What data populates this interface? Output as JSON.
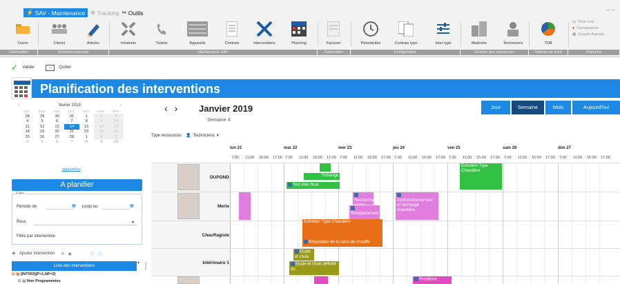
{
  "app_tabs": {
    "active": "SAV - Maintenance",
    "tracking": "Tracking",
    "outils": "Outils"
  },
  "ribbon": {
    "buttons": [
      {
        "label": "Ouvrir",
        "icon": "folder-icon"
      },
      {
        "label": "Clients",
        "icon": "clients-icon"
      },
      {
        "label": "Articles",
        "icon": "pencil-icon"
      },
      {
        "label": "Incidents",
        "icon": "incidents-icon"
      },
      {
        "label": "Tickets",
        "icon": "phone-icon"
      },
      {
        "label": "Appareils",
        "icon": "appliance-icon"
      },
      {
        "label": "Contrats",
        "icon": "contract-icon"
      },
      {
        "label": "Interventions",
        "icon": "tools-icon"
      },
      {
        "label": "Planning",
        "icon": "calendar-icon"
      },
      {
        "label": "Facturer",
        "icon": "invoice-icon"
      },
      {
        "label": "Périodicités",
        "icon": "clock-icon"
      },
      {
        "label": "Contrats type",
        "icon": "contract-type-icon"
      },
      {
        "label": "Inter type",
        "icon": "sliders-icon"
      },
      {
        "label": "Matériels",
        "icon": "materials-icon"
      },
      {
        "label": "Techniciens",
        "icon": "technician-icon"
      },
      {
        "label": "TDB",
        "icon": "dashboard-icon"
      }
    ],
    "groups": [
      "Généralités",
      "Données externes",
      "Maintenance SAV",
      "Facturation",
      "Configuration",
      "Gestion des ressources",
      "Tableau de bord",
      "Planning"
    ],
    "planning_options": [
      "Time Line",
      "Cartographie",
      "Google Agenda"
    ]
  },
  "actions": {
    "validate": "Valider",
    "quit": "Quitter"
  },
  "page_title": "Planification des interventions",
  "minical": {
    "month": "février 2019",
    "weekdays": [
      "lun.",
      "mar.",
      "mer.",
      "jeu.",
      "ven.",
      "sam.",
      "dim."
    ],
    "weeks": [
      [
        "28",
        "29",
        "30",
        "31",
        "1",
        "2",
        "3"
      ],
      [
        "4",
        "5",
        "6",
        "7",
        "8",
        "9",
        "10"
      ],
      [
        "11",
        "12",
        "13",
        "14",
        "15",
        "16",
        "17"
      ],
      [
        "18",
        "19",
        "20",
        "21",
        "22",
        "23",
        "24"
      ],
      [
        "25",
        "26",
        "27",
        "28",
        "1",
        "2",
        "3"
      ],
      [
        "4",
        "5",
        "6",
        "7",
        "8",
        "9",
        "10"
      ]
    ],
    "selected": "14",
    "today_link": "aujourd'hui"
  },
  "a_planifier": "A planifier",
  "filtre": {
    "legend": "Filtre",
    "periode": "Période de",
    "jusqua": "jusqu'au",
    "ress": "Ress",
    "filtre_intervention": "Filtre par intervention"
  },
  "add_intervention": "Ajouter intervention",
  "list_header": "Liste des interventions",
  "tree": {
    "root": "[INT003](P=1,NP=2)",
    "child": "Non Programmées"
  },
  "planner": {
    "month": "Janvier 2019",
    "week": "Semaine 4",
    "views": [
      "Jour",
      "Semaine",
      "Mois",
      "Aujourd'hui"
    ],
    "active_view": "Semaine",
    "type_label": "Type ressources",
    "type_value": "Techniciens",
    "days": [
      "lun 21",
      "mar 22",
      "mer 23",
      "jeu 24",
      "ven 25",
      "sam 26",
      "dim 27"
    ],
    "hours": [
      "7:00",
      "11:00",
      "15:00",
      "17:00"
    ],
    "resources": [
      "DUPOND",
      "Merle",
      "Chauffagiste",
      "Intérimaire 1"
    ],
    "events": [
      {
        "text": "Echange",
        "color": "green"
      },
      {
        "text": "Test inter final",
        "color": "green"
      },
      {
        "text": "Entretien Type Chaudière",
        "color": "green"
      },
      {
        "text": "Recherche panne chaudière",
        "color": "pink"
      },
      {
        "text": "Remplacement",
        "color": "pink"
      },
      {
        "text": "Dysfonctionnement et réchange chaudière",
        "color": "pink"
      },
      {
        "text": "Entretien Type Chaudière",
        "color": "orange"
      },
      {
        "text": "Réparation de la carte de chauffe",
        "color": "orange"
      },
      {
        "text": "Etude et choix",
        "color": "olive"
      },
      {
        "text": "Etude et choix définitif du",
        "color": "olive"
      },
      {
        "text": "Problème",
        "color": "magenta"
      }
    ]
  },
  "colors": {
    "accent": "#1e88e5",
    "green": "#33c144",
    "pink": "#e27de0",
    "orange": "#e86f17",
    "olive": "#9a9a18"
  }
}
